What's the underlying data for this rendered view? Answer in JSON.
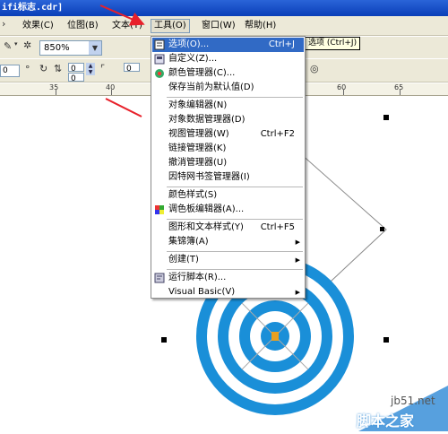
{
  "window": {
    "title": "ifi标志.cdr]"
  },
  "menubar": {
    "items": [
      "效果(C)",
      "位图(B)",
      "文本(T)",
      "工具(O)",
      "窗口(W)",
      "帮助(H)"
    ],
    "active_index": 3
  },
  "toolbar": {
    "zoom": "850%",
    "field1": "0",
    "field2": "0",
    "field3": "0",
    "field4": "0",
    "tooltip": "选项 (Ctrl+J)"
  },
  "ruler": {
    "labels": [
      "35",
      "40",
      "60",
      "65"
    ]
  },
  "dropdown": {
    "items": [
      {
        "label": "选项(O)...",
        "shortcut": "Ctrl+J",
        "icon": "options-icon",
        "highlighted": true
      },
      {
        "label": "自定义(Z)...",
        "shortcut": "",
        "icon": "customize-icon"
      },
      {
        "label": "颜色管理器(C)...",
        "shortcut": "",
        "icon": "color-manager-icon"
      },
      {
        "label": "保存当前为默认值(D)",
        "shortcut": ""
      },
      {
        "label": "对象编辑器(N)",
        "shortcut": ""
      },
      {
        "label": "对象数据管理器(D)",
        "shortcut": ""
      },
      {
        "label": "视图管理器(W)",
        "shortcut": "Ctrl+F2"
      },
      {
        "label": "链接管理器(K)",
        "shortcut": ""
      },
      {
        "label": "撤消管理器(U)",
        "shortcut": ""
      },
      {
        "label": "因特网书签管理器(I)",
        "shortcut": ""
      },
      {
        "label": "颜色样式(S)",
        "shortcut": ""
      },
      {
        "label": "调色板编辑器(A)...",
        "shortcut": "",
        "icon": "palette-icon"
      },
      {
        "label": "图形和文本样式(Y)",
        "shortcut": "Ctrl+F5"
      },
      {
        "label": "集锦簿(A)",
        "shortcut": "",
        "submenu": true
      },
      {
        "label": "创建(T)",
        "shortcut": "",
        "submenu": true
      },
      {
        "label": "运行脚本(R)...",
        "shortcut": "",
        "icon": "script-icon"
      },
      {
        "label": "Visual Basic(V)",
        "shortcut": "",
        "submenu": true
      }
    ]
  },
  "watermark": {
    "line1": "jb51.net",
    "line2": "脚本之家"
  },
  "colors": {
    "target_blue": "#1a8fd8",
    "arrow_red": "#e8202a",
    "highlight": "#316ac5"
  }
}
